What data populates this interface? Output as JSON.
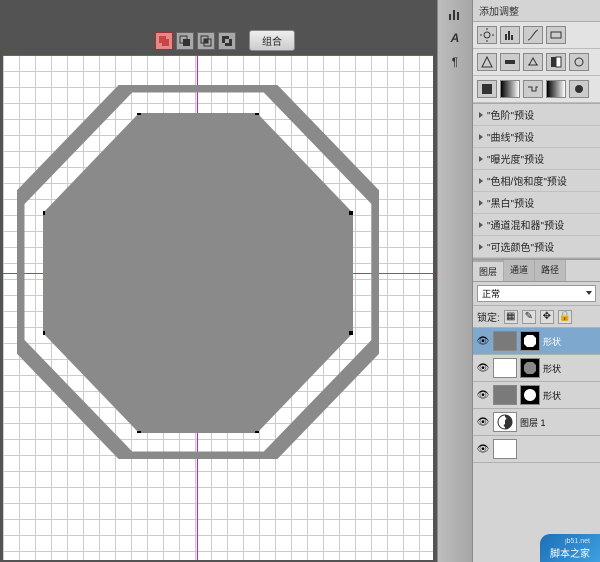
{
  "toolbar": {
    "combine_label": "组合"
  },
  "side_icons": [
    "histogram",
    "A",
    "paragraph"
  ],
  "adjustments": {
    "title": "添加调整",
    "presets": [
      "\"色阶\"预设",
      "\"曲线\"预设",
      "\"曝光度\"预设",
      "\"色相/饱和度\"预设",
      "\"黑白\"预设",
      "\"通道混和器\"预设",
      "\"可选颜色\"预设"
    ]
  },
  "panel_tabs": [
    "图层",
    "通道",
    "路径"
  ],
  "blend_mode": "正常",
  "lock_label": "锁定:",
  "layers": [
    {
      "name": "形状",
      "shape": "oct",
      "selected": true
    },
    {
      "name": "形状",
      "shape": "oct",
      "selected": false
    },
    {
      "name": "形状",
      "shape": "circ",
      "selected": false
    },
    {
      "name": "图层 1",
      "shape": "yy",
      "selected": false
    },
    {
      "name": "",
      "shape": "none",
      "selected": false
    }
  ],
  "footer": {
    "url": "jb51.net",
    "text": "脚本之家"
  }
}
